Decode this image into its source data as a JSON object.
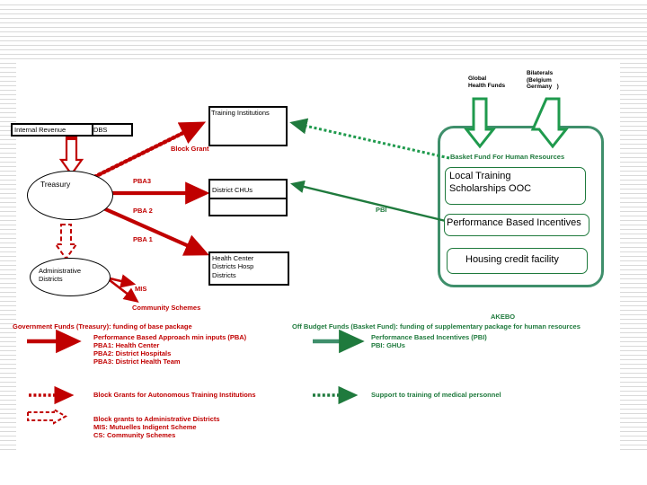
{
  "diagram": {
    "title_hidden": "Health sector financing flows",
    "colors": {
      "red": "#C00000",
      "green": "#1F7A3D",
      "container_green": "#3F8F6B",
      "black": "#000000"
    },
    "top_donors": [
      {
        "id": "global-health-funds",
        "line1": "Global",
        "line2": "Health Funds"
      },
      {
        "id": "bilaterals",
        "line1": "Bilaterals",
        "line2": "(Belgium",
        "line3": "Germany   )"
      }
    ],
    "left_nodes": {
      "internal_revenue": "Internal Revenue",
      "dbs": "DBS",
      "treasury": "Treasury",
      "administrative_districts_line1": "Administrative",
      "administrative_districts_line2": "Districts"
    },
    "center_boxes": {
      "training_institutions": "Training Institutions",
      "district_chus": "District CHUs",
      "health_center_line1": "Health Center",
      "health_center_line2": "Districts Hosp",
      "health_center_line3": "Districts"
    },
    "flow_labels": {
      "block_grant": "Block Grant",
      "pba3": "PBA3",
      "pba2": "PBA 2",
      "pba1": "PBA 1",
      "mis": "MIS",
      "community_schemes": "Community Schemes",
      "pbi": "PBI"
    },
    "basket": {
      "heading": "Basket Fund For Human Resources",
      "items": [
        {
          "id": "local-training",
          "line1": "Local Training",
          "line2": "Scholarships OOC"
        },
        {
          "id": "performance-based-incentives",
          "line1": "Performance Based Incentives"
        },
        {
          "id": "housing-credit-facility",
          "line1": "Housing credit facility"
        }
      ]
    },
    "legend": {
      "left": {
        "solid_arrow_text": "Government Funds (Treasury): funding of base package",
        "solid_sub": [
          "Performance Based Approach min inputs (PBA)",
          "PBA1: Health Center",
          "PBA2: District Hospitals",
          "PBA3: District Health Team"
        ],
        "dashed_arrow_text": "Block Grants for Autonomous Training Institutions",
        "hollow_arrow_lines": [
          "Block grants to Administrative Districts",
          "MIS: Mutuelles Indigent Scheme",
          "CS: Community Schemes"
        ]
      },
      "right": {
        "akebo": "AKEBO",
        "solid_arrow_text": "Off Budget Funds (Basket Fund): funding of supplementary package for human resources",
        "solid_sub": [
          "Performance Based Incentives (PBI)",
          "PBI: GHUs"
        ],
        "dashed_arrow_text": "Support to training of medical personnel"
      }
    }
  }
}
